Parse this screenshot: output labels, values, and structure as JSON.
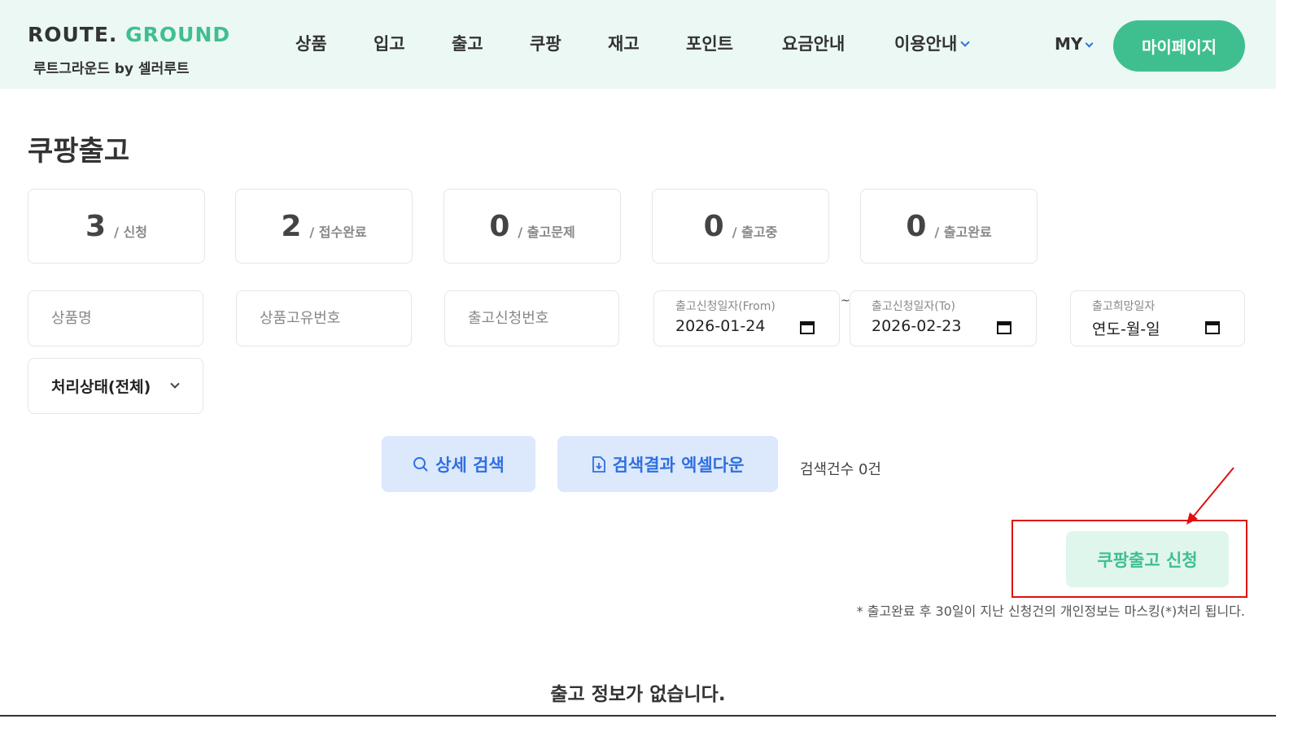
{
  "header": {
    "logo_word1": "ROUTE.",
    "logo_word2": "GROUND",
    "logo_sub": "루트그라운드 by 셀러루트",
    "nav": [
      "상품",
      "입고",
      "출고",
      "쿠팡",
      "재고",
      "포인트",
      "요금안내",
      "이용안내"
    ],
    "my_label": "MY",
    "mypage_label": "마이페이지",
    "accent_color": "#3fbf8f"
  },
  "page": {
    "title": "쿠팡출고"
  },
  "stats": [
    {
      "count": "3",
      "label": "/ 신청"
    },
    {
      "count": "2",
      "label": "/ 접수완료"
    },
    {
      "count": "0",
      "label": "/ 출고문제"
    },
    {
      "count": "0",
      "label": "/ 출고중"
    },
    {
      "count": "0",
      "label": "/ 출고완료"
    }
  ],
  "filters": {
    "product_name_placeholder": "상품명",
    "product_id_placeholder": "상품고유번호",
    "request_no_placeholder": "출고신청번호",
    "date_from_label": "출고신청일자(From)",
    "date_from_value": "2026-01-24",
    "date_to_label": "출고신청일자(To)",
    "date_to_value": "2026-02-23",
    "tilde": "~",
    "wish_date_label": "출고희망일자",
    "wish_date_value": "연도-월-일",
    "status_select": "처리상태(전체)"
  },
  "actions": {
    "detail_search": "상세 검색",
    "excel_download": "검색결과 엑셀다운",
    "result_count": "검색건수 0건",
    "apply": "쿠팡출고 신청"
  },
  "notice": "* 출고완료 후 30일이 지난 신청건의 개인정보는 마스킹(*)처리 됩니다.",
  "empty_message": "출고 정보가 없습니다.",
  "annotation_color": "#e01010"
}
